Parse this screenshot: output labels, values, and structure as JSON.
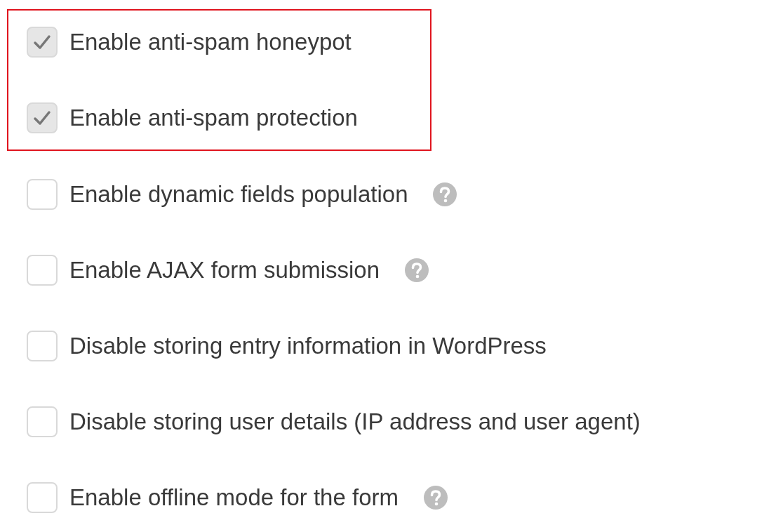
{
  "groups": [
    {
      "highlighted": true,
      "options": [
        {
          "label": "Enable anti-spam honeypot",
          "checked": true,
          "help": false
        },
        {
          "label": "Enable anti-spam protection",
          "checked": true,
          "help": false
        }
      ]
    },
    {
      "highlighted": false,
      "options": [
        {
          "label": "Enable dynamic fields population",
          "checked": false,
          "help": true
        },
        {
          "label": "Enable AJAX form submission",
          "checked": false,
          "help": true
        },
        {
          "label": "Disable storing entry information in WordPress",
          "checked": false,
          "help": false
        },
        {
          "label": "Disable storing user details (IP address and user agent)",
          "checked": false,
          "help": false
        },
        {
          "label": "Enable offline mode for the form",
          "checked": false,
          "help": true
        }
      ]
    }
  ]
}
